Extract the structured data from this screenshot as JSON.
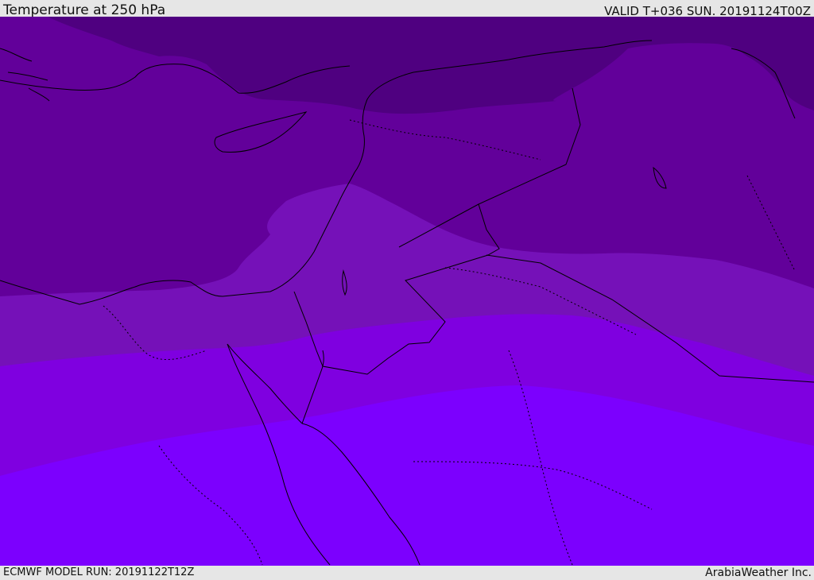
{
  "header": {
    "title": "Temperature at 250 hPa",
    "valid_time": "VALID T+036 SUN. 20191124T00Z"
  },
  "footer": {
    "model_run": "ECMWF MODEL RUN: 20191122T12Z",
    "credit": "ArabiaWeather Inc."
  },
  "colors": {
    "band_coldest": "#4f0080",
    "band_cold": "#62009a",
    "band_mid": "#7511b8",
    "band_warm": "#7f00e0",
    "band_warmest": "#7c00fe",
    "coastline": "#000000",
    "frame": "#e6e6e6"
  }
}
